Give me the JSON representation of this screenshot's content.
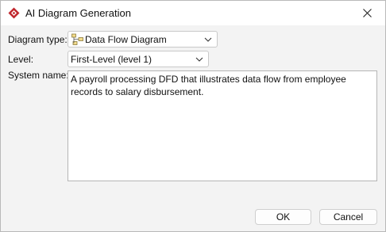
{
  "window": {
    "title": "AI Diagram Generation"
  },
  "form": {
    "diagram_type_label": "Diagram type:",
    "diagram_type_value": "Data Flow Diagram",
    "level_label": "Level:",
    "level_value": "First-Level (level 1)",
    "system_name_label": "System name:",
    "system_name_value": "A payroll processing DFD that illustrates data flow from employee records to salary disbursement."
  },
  "buttons": {
    "ok": "OK",
    "cancel": "Cancel"
  },
  "colors": {
    "app_icon": "#c0272d",
    "window_bg": "#f3f3f3",
    "field_border": "#c9c9c9"
  },
  "icons": {
    "app": "diamond-logo-icon",
    "close": "close-icon",
    "diagram_type": "data-flow-diagram-icon",
    "dropdown": "chevron-down-icon"
  }
}
